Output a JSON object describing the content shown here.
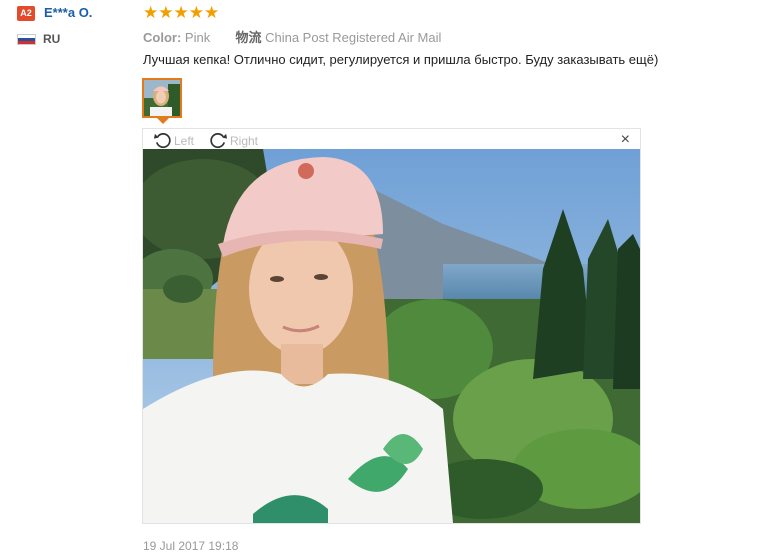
{
  "reviewer": {
    "level_badge": "A2",
    "name": "E***a O.",
    "country": "RU",
    "flag_icon": "russia-flag-icon"
  },
  "rating": {
    "stars": 5,
    "max": 5,
    "display": "★★★★★",
    "color": "#f0a000"
  },
  "meta": {
    "color_label": "Color:",
    "color_value": "Pink",
    "logistics_icon": "物流",
    "shipping": "China Post Registered Air Mail"
  },
  "review_text": "Лучшая кепка! Отлично сидит, регулируется и пришла быстро. Буду заказывать ещё)",
  "viewer": {
    "rotate_left_label": "Left",
    "rotate_right_label": "Right",
    "close_symbol": "×"
  },
  "date": "19 Jul 2017 19:18",
  "colors": {
    "accent": "#e27b1c",
    "link": "#1a5ea8",
    "badge": "#e34b2b"
  }
}
